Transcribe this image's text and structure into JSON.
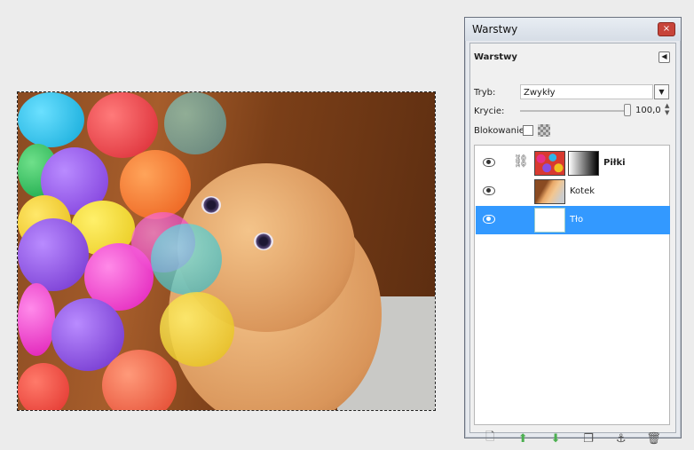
{
  "window": {
    "title": "Warstwy",
    "close_glyph": "×"
  },
  "panel": {
    "header": "Warstwy",
    "mode_label": "Tryb:",
    "mode_value": "Zwykły",
    "opacity_label": "Krycie:",
    "opacity_value": "100,0",
    "lock_label": "Blokowanie:"
  },
  "layers": [
    {
      "name": "Piłki",
      "visible": true,
      "linked": true,
      "has_mask": true,
      "selected": false
    },
    {
      "name": "Kotek",
      "visible": true,
      "linked": false,
      "has_mask": false,
      "selected": false
    },
    {
      "name": "Tło",
      "visible": true,
      "linked": false,
      "has_mask": false,
      "selected": true
    }
  ],
  "footer_buttons": [
    {
      "name": "new-layer-icon"
    },
    {
      "name": "raise-layer-icon"
    },
    {
      "name": "lower-layer-icon"
    },
    {
      "name": "duplicate-layer-icon"
    },
    {
      "name": "anchor-layer-icon"
    },
    {
      "name": "delete-layer-icon"
    }
  ],
  "colors": {
    "selection": "#3399ff",
    "raise_arrow": "#5cb85c",
    "close_button": "#c7443a"
  }
}
